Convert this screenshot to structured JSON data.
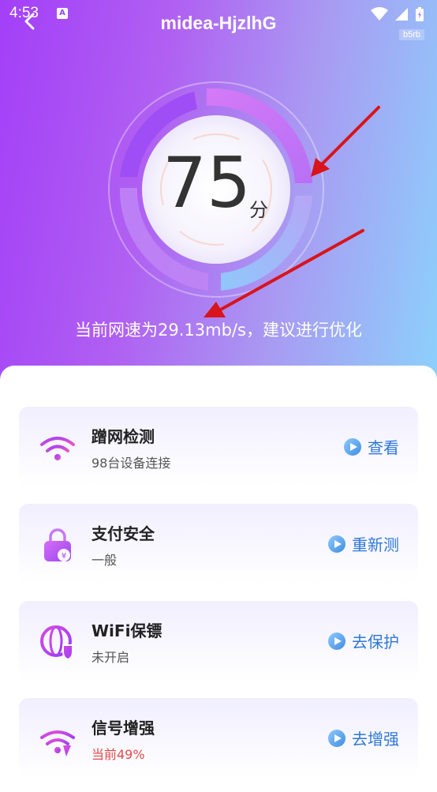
{
  "statusbar": {
    "time": "4:53"
  },
  "header": {
    "title": "midea-HjzlhG",
    "tag": "b5rb"
  },
  "score": {
    "value": "75",
    "unit": "分",
    "level": 0.75
  },
  "speed_text": "当前网速为29.13mb/s，建议进行优化",
  "cards": [
    {
      "title": "蹭网检测",
      "subtitle": "98台设备连接",
      "action": "查看",
      "icon": "wifi-icon"
    },
    {
      "title": "支付安全",
      "subtitle": "一般",
      "action": "重新测",
      "icon": "lock-icon"
    },
    {
      "title": "WiFi保镖",
      "subtitle": "未开启",
      "action": "去保护",
      "icon": "globe-shield-icon"
    },
    {
      "title": "信号增强",
      "subtitle": "当前49%",
      "action": "去增强",
      "icon": "signal-boost-icon"
    }
  ],
  "colors": {
    "accent_purple": "#a33ff8",
    "accent_blue": "#2f78d8",
    "warn_red": "#e24a4a",
    "arrow_red": "#d8141c"
  }
}
